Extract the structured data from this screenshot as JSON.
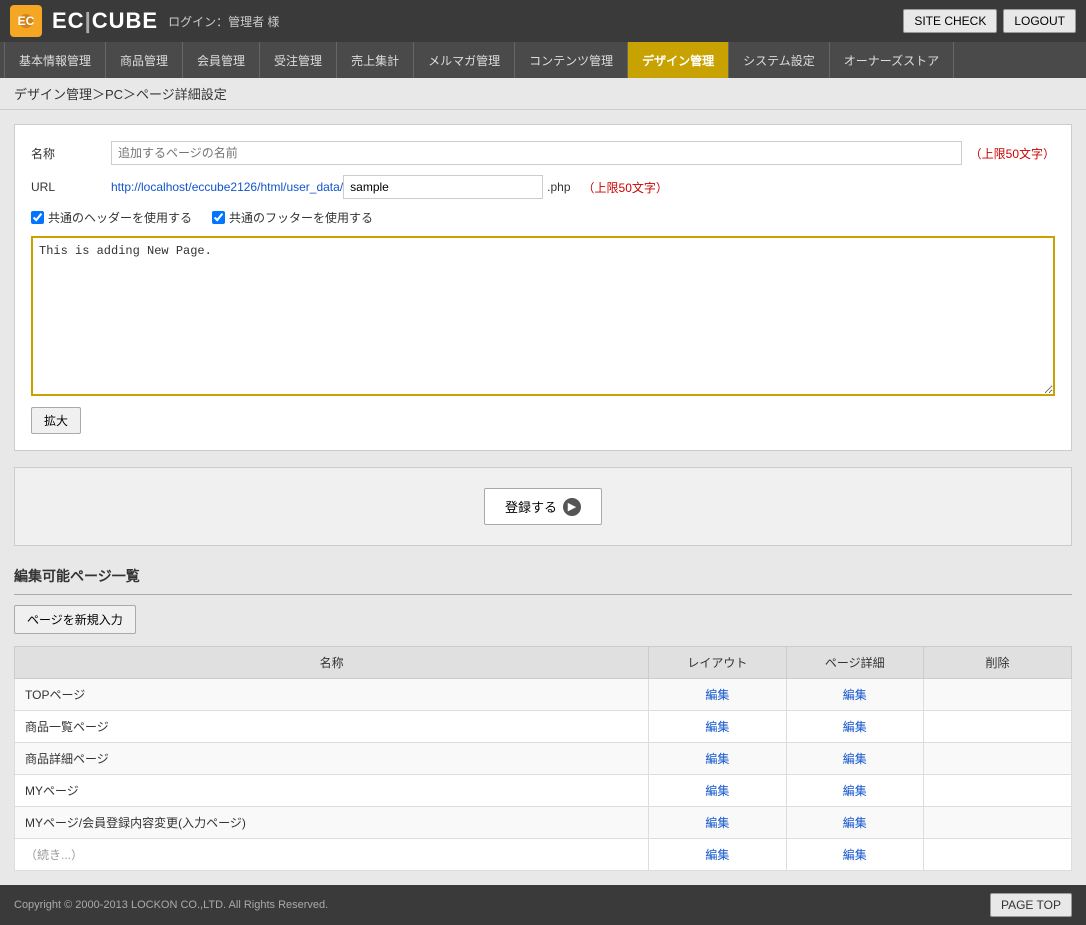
{
  "header": {
    "logo_letter": "★",
    "logo_brand": "EC｜CUBE",
    "user_label": "ログイン：管理者 様",
    "site_check": "SITE CHECK",
    "logout": "LOGOUT"
  },
  "nav": {
    "items": [
      {
        "id": "basic",
        "label": "基本情報管理",
        "active": false
      },
      {
        "id": "product",
        "label": "商品管理",
        "active": false
      },
      {
        "id": "member",
        "label": "会員管理",
        "active": false
      },
      {
        "id": "order",
        "label": "受注管理",
        "active": false
      },
      {
        "id": "sales",
        "label": "売上集計",
        "active": false
      },
      {
        "id": "mail",
        "label": "メルマガ管理",
        "active": false
      },
      {
        "id": "content",
        "label": "コンテンツ管理",
        "active": false
      },
      {
        "id": "design",
        "label": "デザイン管理",
        "active": true
      },
      {
        "id": "system",
        "label": "システム設定",
        "active": false
      },
      {
        "id": "owners",
        "label": "オーナーズストア",
        "active": false
      }
    ]
  },
  "breadcrumb": "デザイン管理＞PC＞ページ詳細設定",
  "form": {
    "name_label": "名称",
    "name_placeholder": "追加するページの名前",
    "name_hint": "（上限50文字）",
    "url_label": "URL",
    "url_prefix": "http://localhost/eccube2126/html/user_data/",
    "url_value": "sample",
    "url_suffix": ".php",
    "url_hint": "（上限50文字）",
    "header_checkbox_label": "☑ 共通のヘッダーを使用する",
    "footer_checkbox_label": "☑ 共通のフッターを使用する",
    "editor_content": "This is adding New Page.",
    "expand_label": "拡大"
  },
  "register": {
    "button_label": "登録する"
  },
  "pages_section": {
    "title": "編集可能ページ一覧",
    "new_page_btn": "ページを新規入力",
    "table": {
      "headers": [
        "名称",
        "レイアウト",
        "ページ詳細",
        "削除"
      ],
      "rows": [
        {
          "name": "TOPページ",
          "layout": "編集",
          "detail": "編集",
          "delete": ""
        },
        {
          "name": "商品一覧ページ",
          "layout": "編集",
          "detail": "編集",
          "delete": ""
        },
        {
          "name": "商品詳細ページ",
          "layout": "編集",
          "detail": "編集",
          "delete": ""
        },
        {
          "name": "MYページ",
          "layout": "編集",
          "detail": "編集",
          "delete": ""
        },
        {
          "name": "MYページ/会員登録内容変更(入力ページ)",
          "layout": "編集",
          "detail": "編集",
          "delete": ""
        },
        {
          "name": "（続き）",
          "layout": "編集",
          "detail": "編集",
          "delete": ""
        }
      ]
    }
  },
  "footer": {
    "copyright": "Copyright © 2000-2013 LOCKON CO.,LTD. All Rights Reserved.",
    "page_top": "PAGE TOP"
  }
}
